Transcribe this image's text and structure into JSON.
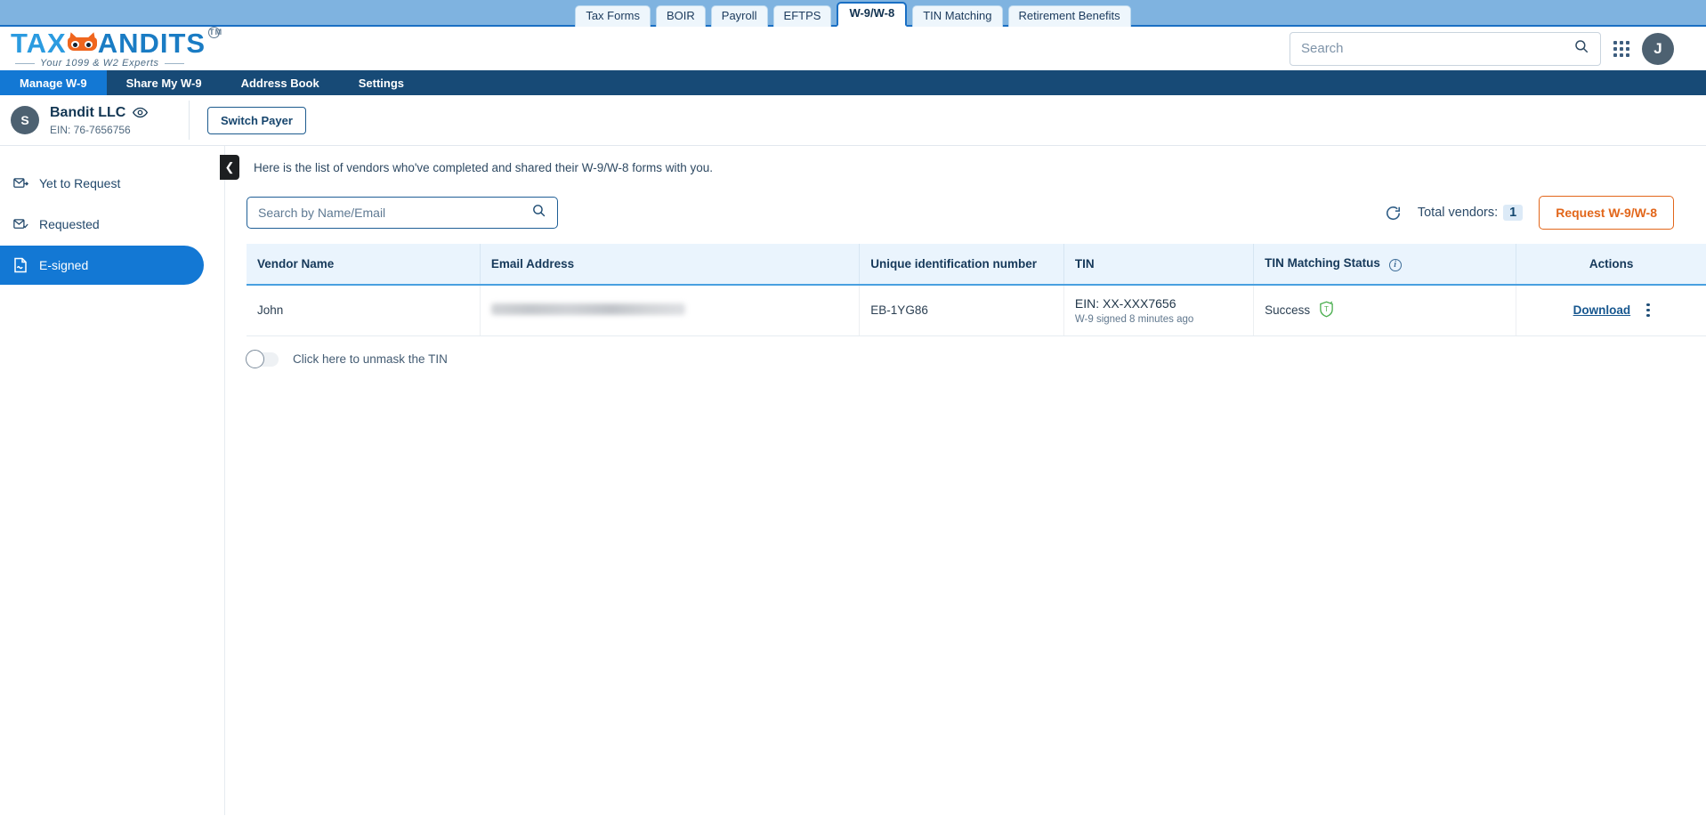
{
  "product_tabs": [
    {
      "label": "Tax Forms",
      "active": false
    },
    {
      "label": "BOIR",
      "active": false
    },
    {
      "label": "Payroll",
      "active": false
    },
    {
      "label": "EFTPS",
      "active": false
    },
    {
      "label": "W-9/W-8",
      "active": true
    },
    {
      "label": "TIN Matching",
      "active": false
    },
    {
      "label": "Retirement Benefits",
      "active": false
    }
  ],
  "brand": {
    "name_part1": "TAX",
    "name_part2": "ANDITS",
    "trademark": "TM",
    "tagline": "Your 1099 & W2 Experts",
    "logo_blue": "#2b9be0",
    "logo_orange": "#f0661e"
  },
  "header": {
    "search_placeholder": "Search",
    "search_value": "",
    "apps_icon": "grid-apps-icon",
    "avatar_initial": "J"
  },
  "nav": [
    {
      "label": "Manage W-9",
      "active": true
    },
    {
      "label": "Share My W-9",
      "active": false
    },
    {
      "label": "Address Book",
      "active": false
    },
    {
      "label": "Settings",
      "active": false
    }
  ],
  "payer": {
    "avatar_initial": "S",
    "name": "Bandit LLC",
    "ein": "EIN: 76-7656756",
    "eye_icon": "eye-icon",
    "switch_payer_label": "Switch Payer"
  },
  "sidebar": [
    {
      "label": "Yet to Request",
      "icon": "envelope-arrow-icon",
      "active": false
    },
    {
      "label": "Requested",
      "icon": "envelope-check-icon",
      "active": false
    },
    {
      "label": "E-signed",
      "icon": "document-signed-icon",
      "active": true
    }
  ],
  "content": {
    "collapse_icon": "chevron-left-icon",
    "info_text": "Here is the list of vendors who've completed and shared their W-9/W-8 forms with you.",
    "list_search_placeholder": "Search by Name/Email",
    "list_search_value": "",
    "refresh_icon": "refresh-icon",
    "total_vendors_label": "Total vendors:",
    "total_vendors_count": "1",
    "request_button_label": "Request W-9/W-8",
    "request_button_color": "#e2661a",
    "unmask_label": "Click here to unmask the TIN",
    "unmask_toggle_state": "off"
  },
  "table": {
    "columns": [
      "Vendor Name",
      "Email Address",
      "Unique identification number",
      "TIN",
      "TIN Matching Status",
      "Actions"
    ],
    "tin_status_info_icon": "info-icon",
    "rows": [
      {
        "vendor_name": "John",
        "email": "",
        "email_masked": true,
        "unique_id": "EB-1YG86",
        "tin": "EIN: XX-XXX7656",
        "tin_sub": "W-9 signed 8 minutes ago",
        "status": "Success",
        "status_icon": "shield-tin-verified-icon",
        "status_color": "#4caf50",
        "download_label": "Download",
        "kebab_icon": "more-vertical-icon"
      }
    ]
  }
}
